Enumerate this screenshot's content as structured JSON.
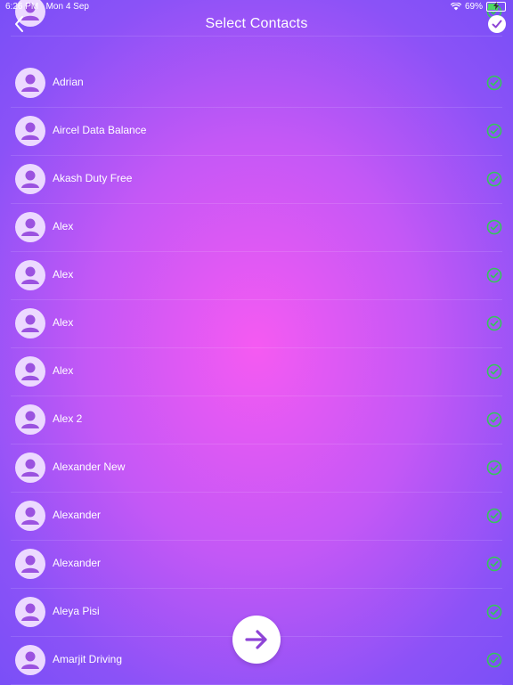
{
  "status_bar": {
    "time": "6:26 PM",
    "date": "Mon 4 Sep",
    "battery_percent": "69%",
    "battery_level": 0.69,
    "wifi_icon": "wifi-icon",
    "charging_icon": "bolt-icon"
  },
  "nav": {
    "title": "Select Contacts",
    "back_icon": "chevron-left-icon",
    "done_icon": "checkmark-icon"
  },
  "contacts": [
    {
      "name": "Adrian",
      "selected": true
    },
    {
      "name": "Aircel Data Balance",
      "selected": true
    },
    {
      "name": "Akash Duty Free",
      "selected": true
    },
    {
      "name": "Alex",
      "selected": true
    },
    {
      "name": "Alex",
      "selected": true
    },
    {
      "name": "Alex",
      "selected": true
    },
    {
      "name": "Alex",
      "selected": true
    },
    {
      "name": "Alex 2",
      "selected": true
    },
    {
      "name": "Alexander New",
      "selected": true
    },
    {
      "name": "Alexander",
      "selected": true
    },
    {
      "name": "Alexander",
      "selected": true
    },
    {
      "name": "Aleya Pisi",
      "selected": true
    },
    {
      "name": "Amarjit Driving",
      "selected": true
    }
  ],
  "fab": {
    "icon": "arrow-right-icon"
  },
  "colors": {
    "accent": "#8e44d6",
    "check": "#34c759",
    "avatar_bg": "#ecd9ff"
  }
}
